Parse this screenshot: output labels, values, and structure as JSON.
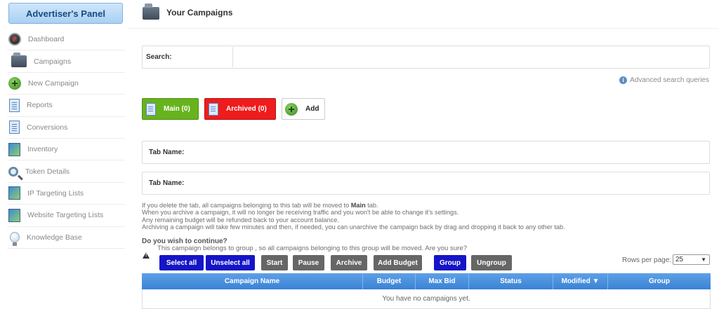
{
  "sidebar": {
    "header": "Advertiser's Panel",
    "items": [
      {
        "label": "Dashboard",
        "icon": "dashboard-icon"
      },
      {
        "label": "Campaigns",
        "icon": "campaigns-icon"
      },
      {
        "label": "New Campaign",
        "icon": "add-icon"
      },
      {
        "label": "Reports",
        "icon": "report-icon"
      },
      {
        "label": "Conversions",
        "icon": "report-icon"
      },
      {
        "label": "Inventory",
        "icon": "pictures-icon"
      },
      {
        "label": "Token Details",
        "icon": "magnifier-icon"
      },
      {
        "label": "IP Targeting Lists",
        "icon": "pictures-icon"
      },
      {
        "label": "Website Targeting Lists",
        "icon": "pictures-icon"
      },
      {
        "label": "Knowledge Base",
        "icon": "bulb-icon"
      }
    ]
  },
  "page": {
    "title": "Your Campaigns"
  },
  "search": {
    "label": "Search:",
    "value": "",
    "advanced_link": "Advanced search queries"
  },
  "tabs": {
    "main": "Main (0)",
    "archived": "Archived (0)",
    "add": "Add"
  },
  "tab_name": {
    "label_1": "Tab Name:",
    "label_2": "Tab Name:",
    "value_1": "",
    "value_2": ""
  },
  "notes": {
    "line1_prefix": "If you delete the tab, all campaigns belonging to this tab will be moved to ",
    "line1_bold": "Main",
    "line1_suffix": " tab.",
    "line2": "When you archive a campaign, it will no longer be receiving traffic and you won't be able to change it's settings.",
    "line3": "Any remaining budget will be refunded back to your account balance.",
    "line4": "Archiving a campaign will take few minutes and then, if needed, you can unarchive the campaign back by drag and dropping it back to any other tab."
  },
  "confirm": {
    "title": "Do you wish to continue?",
    "group_notice": "This campaign belongs to group , so all campaigns belonging to this group will be moved. Are you sure?"
  },
  "actions": {
    "select_all": "Select all",
    "unselect_all": "Unselect all",
    "start": "Start",
    "pause": "Pause",
    "archive": "Archive",
    "add_budget": "Add Budget",
    "group": "Group",
    "ungroup": "Ungroup"
  },
  "rows_per_page": {
    "label": "Rows per page:",
    "value": "25"
  },
  "table": {
    "columns": [
      "Campaign Name",
      "Budget",
      "Max Bid",
      "Status",
      "Modified ▼",
      "Group"
    ],
    "empty_message": "You have no campaigns yet."
  },
  "colors": {
    "accent_blue": "#1515c8",
    "header_blue": "#3b82d4",
    "main_tab_green": "#66b31e",
    "archived_tab_red": "#ee1c1c",
    "gray_button": "#666666"
  }
}
